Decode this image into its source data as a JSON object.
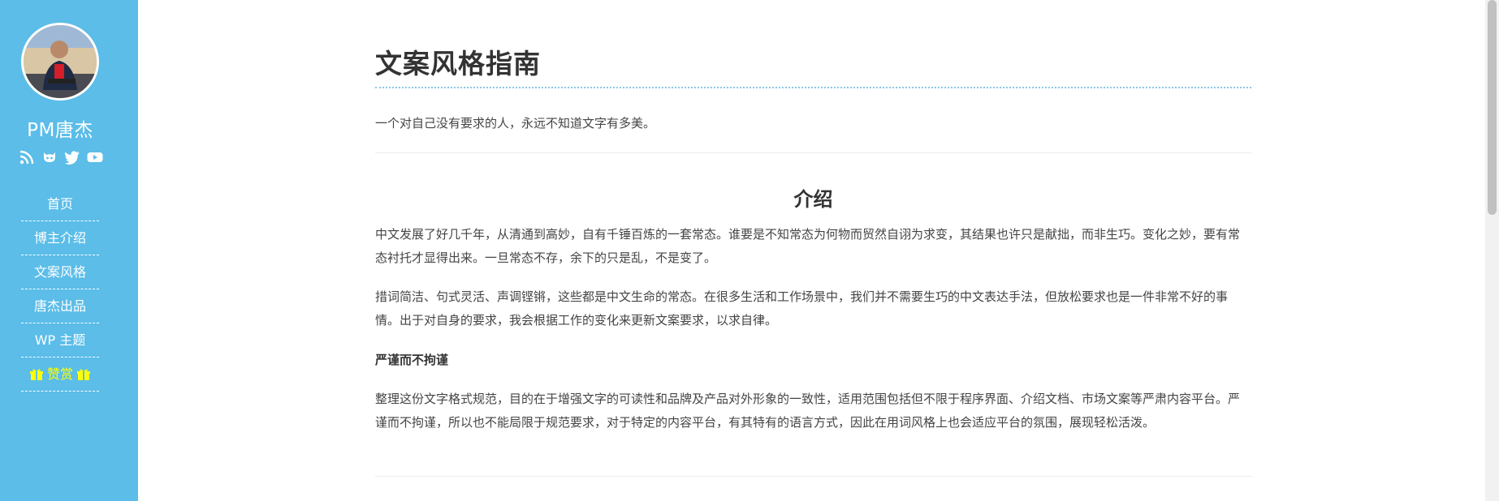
{
  "sidebar": {
    "site_name": "PM唐杰",
    "social_icons": [
      "rss-icon",
      "github-icon",
      "twitter-icon",
      "youtube-icon"
    ],
    "nav": [
      {
        "label": "首页"
      },
      {
        "label": "博主介绍"
      },
      {
        "label": "文案风格"
      },
      {
        "label": "唐杰出品"
      },
      {
        "label": "WP 主题"
      },
      {
        "label": "赞赏",
        "icon": "gift-icon"
      }
    ],
    "colors": {
      "background": "#5bbde8",
      "donate": "#ffff00"
    }
  },
  "article": {
    "title": "文案风格指南",
    "subtitle": "一个对自己没有要求的人，永远不知道文字有多美。",
    "section_title": "介绍",
    "paragraphs": [
      "中文发展了好几千年，从清通到高妙，自有千锤百炼的一套常态。谁要是不知常态为何物而贸然自诩为求变，其结果也许只是献拙，而非生巧。变化之妙，要有常态衬托才显得出来。一旦常态不存，余下的只是乱，不是变了。",
      "措词简洁、句式灵活、声调铿锵，这些都是中文生命的常态。在很多生活和工作场景中，我们并不需要生巧的中文表达手法，但放松要求也是一件非常不好的事情。出于对自身的要求，我会根据工作的变化来更新文案要求，以求自律。"
    ],
    "subheading": "严谨而不拘谨",
    "paragraph3": "整理这份文字格式规范，目的在于增强文字的可读性和品牌及产品对外形象的一致性，适用范围包括但不限于程序界面、介绍文档、市场文案等严肃内容平台。严谨而不拘谨，所以也不能局限于规范要求，对于特定的内容平台，有其特有的语言方式，因此在用词风格上也会适应平台的氛围，展现轻松活泼。"
  }
}
